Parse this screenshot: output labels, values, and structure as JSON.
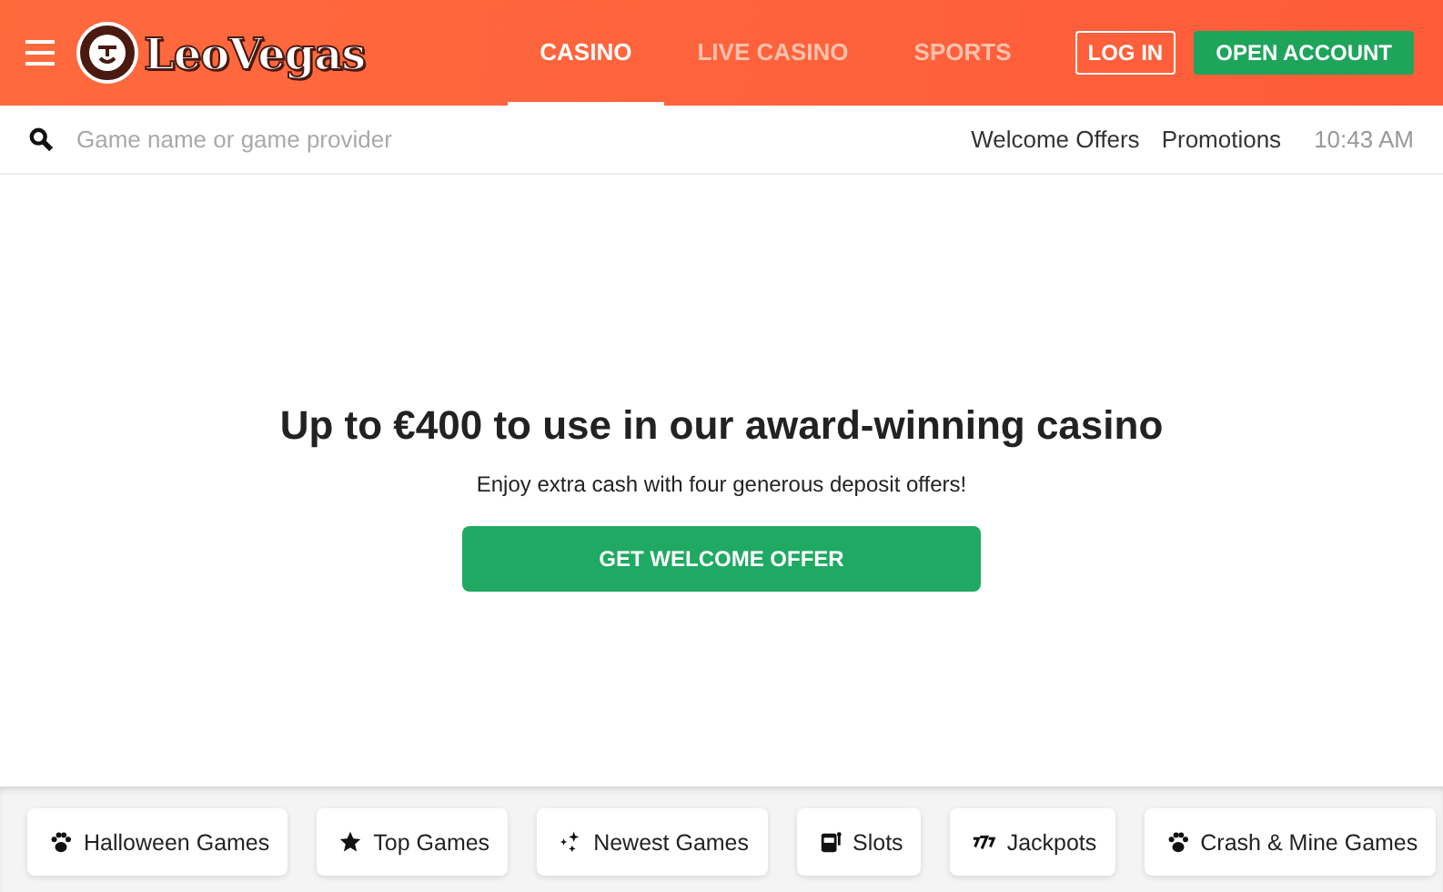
{
  "header": {
    "logo": "LeoVegas",
    "nav": [
      {
        "label": "CASINO",
        "selected": true
      },
      {
        "label": "LIVE CASINO",
        "selected": false
      },
      {
        "label": "SPORTS",
        "selected": false
      }
    ],
    "login": "LOG IN",
    "open_account": "OPEN ACCOUNT"
  },
  "search": {
    "placeholder": "Game name or game provider"
  },
  "links": [
    "Welcome Offers",
    "Promotions"
  ],
  "time": "10:43 AM",
  "hero": {
    "title": "Up to €400 to use in our award-winning casino",
    "subtitle": "Enjoy extra cash with four generous deposit offers!",
    "button": "GET WELCOME OFFER"
  },
  "categories": [
    {
      "label": "Halloween Games",
      "kind": "paw"
    },
    {
      "label": "Top Games",
      "kind": "star"
    },
    {
      "label": "Newest Games",
      "kind": "sparkle"
    },
    {
      "label": "Slots",
      "kind": "slot"
    },
    {
      "label": "Jackpots",
      "kind": "sevens"
    },
    {
      "label": "Crash & Mine Games",
      "kind": "paw"
    }
  ]
}
